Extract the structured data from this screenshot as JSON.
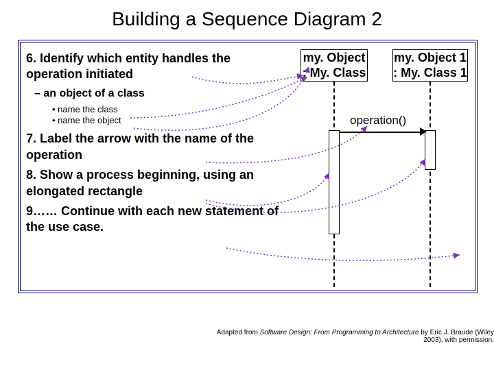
{
  "title": "Building a Sequence Diagram 2",
  "steps": {
    "s6": "6. Identify which entity handles the operation initiated",
    "s6sub": "– an object of a class",
    "s6b1": "• name the class",
    "s6b2": "• name the object",
    "s7": "7. Label the arrow with the name of the operation",
    "s8": "8. Show a process beginning, using an elongated rectangle",
    "s9": "9…… Continue with each new statement of the use case."
  },
  "lifelines": {
    "obj1_name": "my. Object",
    "obj1_class": ": My. Class",
    "obj2_name": "my. Object 1",
    "obj2_class": ": My. Class 1"
  },
  "message": "operation()",
  "credit_prefix": "Adapted from ",
  "credit_title": "Software Design: From Programming to Architecture",
  "credit_suffix": " by Eric J. Braude (Wiley 2003), with permission."
}
